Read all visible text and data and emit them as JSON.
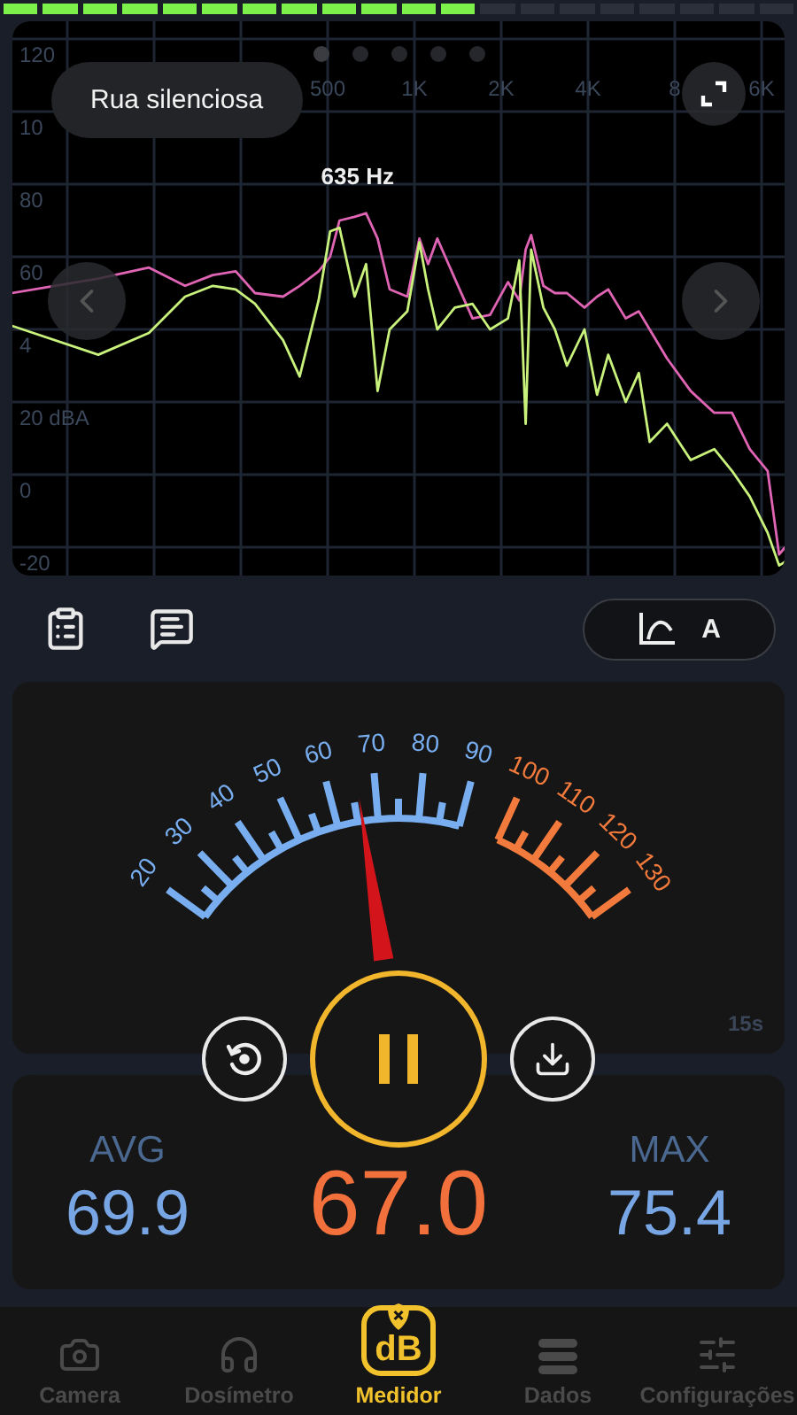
{
  "spectrum": {
    "preset": "Rua silenciosa",
    "pages": [
      {
        "selected": true
      },
      {
        "selected": false
      },
      {
        "selected": false
      },
      {
        "selected": false
      },
      {
        "selected": false
      }
    ],
    "x_labels": [
      "500",
      "1K",
      "2K",
      "4K",
      "8",
      "6K"
    ],
    "y_labels": [
      "120",
      "10",
      "80",
      "60",
      "4",
      "20 dBA",
      "0",
      "-20"
    ],
    "peak_label": "635 Hz"
  },
  "toolbar": {
    "weighting": "A"
  },
  "meter": {
    "duration": "15s",
    "scale": [
      {
        "label": "20",
        "color": "#78aef0"
      },
      {
        "label": "30",
        "color": "#78aef0"
      },
      {
        "label": "40",
        "color": "#78aef0"
      },
      {
        "label": "50",
        "color": "#78aef0"
      },
      {
        "label": "60",
        "color": "#78aef0"
      },
      {
        "label": "70",
        "color": "#78aef0"
      },
      {
        "label": "80",
        "color": "#78aef0"
      },
      {
        "label": "90",
        "color": "#78aef0"
      },
      {
        "label": "100",
        "color": "#f27a3c"
      },
      {
        "label": "110",
        "color": "#f27a3c"
      },
      {
        "label": "120",
        "color": "#f27a3c"
      },
      {
        "label": "130",
        "color": "#f27a3c"
      }
    ]
  },
  "controls": {
    "running": true
  },
  "stats": {
    "avg": {
      "label": "AVG",
      "value": "69.9"
    },
    "current": "67.0",
    "max": {
      "label": "MAX",
      "value": "75.4"
    }
  },
  "tabs": [
    {
      "kind": "camera",
      "label": "Camera",
      "selected": false
    },
    {
      "kind": "headphones",
      "label": "Dosímetro",
      "selected": false
    },
    {
      "kind": "meter",
      "label": "Medidor",
      "badge": "dB",
      "selected": true
    },
    {
      "kind": "list",
      "label": "Dados",
      "selected": false
    },
    {
      "kind": "sliders",
      "label": "Configurações",
      "selected": false
    }
  ]
}
